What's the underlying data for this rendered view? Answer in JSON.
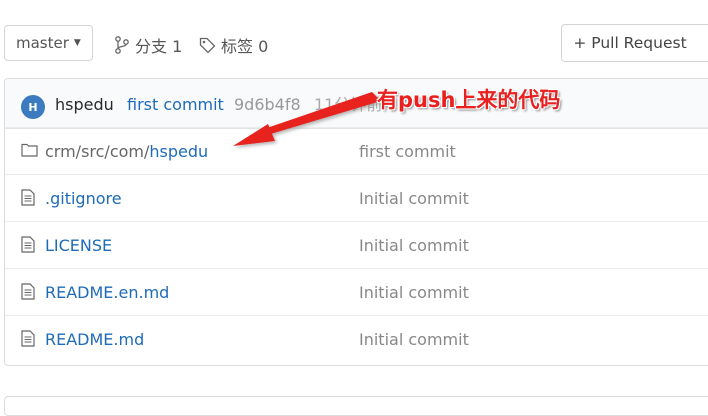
{
  "toolbar": {
    "branch": "master",
    "branches_label": "分支 1",
    "tags_label": "标签 0",
    "pull_request_label": "+ Pull Request"
  },
  "commit_bar": {
    "avatar_letter": "H",
    "author": "hspedu",
    "message": "first commit",
    "sha": "9d6b4f8",
    "time": "11分钟前"
  },
  "files": [
    {
      "path_prefix": "crm/src/com/",
      "name": "hspedu",
      "type": "folder",
      "commit": "first commit"
    },
    {
      "path_prefix": "",
      "name": ".gitignore",
      "type": "file",
      "commit": "Initial commit"
    },
    {
      "path_prefix": "",
      "name": "LICENSE",
      "type": "file",
      "commit": "Initial commit"
    },
    {
      "path_prefix": "",
      "name": "README.en.md",
      "type": "file",
      "commit": "Initial commit"
    },
    {
      "path_prefix": "",
      "name": "README.md",
      "type": "file",
      "commit": "Initial commit"
    }
  ],
  "annotation": {
    "text": "有push上来的代码",
    "color": "#e8201f"
  },
  "icons": {
    "branch": "branch-icon",
    "tag": "tag-icon",
    "folder": "folder-icon",
    "file": "file-icon"
  }
}
